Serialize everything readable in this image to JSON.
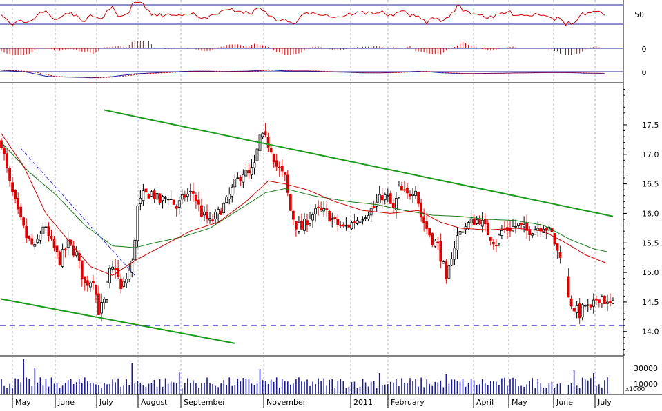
{
  "chart_data": {
    "type": "ohlc",
    "title": "",
    "price_axis": {
      "ylim": [
        13.6,
        18.2
      ],
      "ticks": [
        14.0,
        14.5,
        15.0,
        15.5,
        16.0,
        16.5,
        17.0,
        17.5
      ],
      "tick_labels": [
        "14.0",
        "14.5",
        "15.0",
        "15.5",
        "16.0",
        "16.5",
        "17.0",
        "17.5"
      ]
    },
    "indicator_axes": {
      "rsi": {
        "tick_labels": [
          "50"
        ],
        "upper_line": 70,
        "lower_line": 30
      },
      "macd_histogram": {
        "tick_labels": [
          "0"
        ]
      },
      "macd": {
        "tick_labels": [
          "0"
        ]
      }
    },
    "volume_axis": {
      "tick_labels": [
        "30000",
        "10000"
      ],
      "multiplier_label": "x1000"
    },
    "months": [
      "May",
      "June",
      "July",
      "August",
      "September",
      "November",
      "2011",
      "February",
      "April",
      "May",
      "June",
      "July"
    ],
    "close_path": [
      [
        0,
        17.2
      ],
      [
        3,
        16.5
      ],
      [
        6,
        16.0
      ],
      [
        9,
        15.6
      ],
      [
        12,
        15.4
      ],
      [
        15,
        15.8
      ],
      [
        18,
        15.5
      ],
      [
        21,
        15.2
      ],
      [
        24,
        15.5
      ],
      [
        27,
        15.3
      ],
      [
        30,
        14.8
      ],
      [
        33,
        14.9
      ],
      [
        35,
        14.35
      ],
      [
        37,
        14.5
      ],
      [
        39,
        15.0
      ],
      [
        41,
        15.1
      ],
      [
        43,
        14.7
      ],
      [
        45,
        14.9
      ],
      [
        47,
        15.15
      ],
      [
        48,
        15.6
      ],
      [
        49,
        16.1
      ],
      [
        51,
        16.3
      ],
      [
        54,
        16.35
      ],
      [
        57,
        16.2
      ],
      [
        60,
        16.3
      ],
      [
        63,
        16.1
      ],
      [
        66,
        16.3
      ],
      [
        69,
        16.35
      ],
      [
        72,
        16.0
      ],
      [
        75,
        15.85
      ],
      [
        78,
        16.0
      ],
      [
        81,
        16.2
      ],
      [
        84,
        16.5
      ],
      [
        87,
        16.7
      ],
      [
        89,
        16.65
      ],
      [
        91,
        16.8
      ],
      [
        93,
        17.3
      ],
      [
        95,
        17.25
      ],
      [
        97,
        17.1
      ],
      [
        99,
        16.8
      ],
      [
        102,
        16.6
      ],
      [
        104,
        16.05
      ],
      [
        106,
        15.8
      ],
      [
        108,
        15.75
      ],
      [
        111,
        15.95
      ],
      [
        114,
        16.05
      ],
      [
        117,
        16.0
      ],
      [
        120,
        15.85
      ],
      [
        123,
        15.75
      ],
      [
        125,
        15.8
      ],
      [
        128,
        15.9
      ],
      [
        131,
        16.0
      ],
      [
        134,
        16.1
      ],
      [
        137,
        16.3
      ],
      [
        139,
        16.25
      ],
      [
        141,
        16.05
      ],
      [
        143,
        16.4
      ],
      [
        146,
        16.3
      ],
      [
        149,
        16.45
      ],
      [
        151,
        15.95
      ],
      [
        153,
        15.75
      ],
      [
        155,
        15.55
      ],
      [
        157,
        15.45
      ],
      [
        159,
        15.1
      ],
      [
        160,
        14.8
      ],
      [
        162,
        15.3
      ],
      [
        164,
        15.6
      ],
      [
        166,
        15.75
      ],
      [
        169,
        15.85
      ],
      [
        172,
        15.9
      ],
      [
        174,
        15.75
      ],
      [
        176,
        15.6
      ],
      [
        178,
        15.5
      ],
      [
        180,
        15.7
      ],
      [
        183,
        15.75
      ],
      [
        186,
        15.8
      ],
      [
        189,
        15.7
      ],
      [
        192,
        15.75
      ],
      [
        195,
        15.8
      ],
      [
        198,
        15.65
      ],
      [
        200,
        15.35
      ],
      [
        202,
        15.3
      ],
      [
        204,
        14.55
      ],
      [
        206,
        14.4
      ],
      [
        208,
        14.3
      ],
      [
        210,
        14.45
      ],
      [
        212,
        14.35
      ],
      [
        214,
        14.55
      ],
      [
        216,
        14.6
      ],
      [
        218,
        14.45
      ]
    ],
    "ma_long_path": [
      [
        0,
        17.2
      ],
      [
        10,
        16.7
      ],
      [
        20,
        16.3
      ],
      [
        30,
        15.8
      ],
      [
        40,
        15.45
      ],
      [
        48,
        15.42
      ],
      [
        55,
        15.5
      ],
      [
        65,
        15.6
      ],
      [
        75,
        15.75
      ],
      [
        85,
        16.05
      ],
      [
        95,
        16.35
      ],
      [
        102,
        16.42
      ],
      [
        112,
        16.3
      ],
      [
        125,
        16.2
      ],
      [
        135,
        16.15
      ],
      [
        145,
        16.05
      ],
      [
        155,
        15.97
      ],
      [
        165,
        15.95
      ],
      [
        175,
        15.9
      ],
      [
        185,
        15.88
      ],
      [
        195,
        15.8
      ],
      [
        205,
        15.55
      ],
      [
        213,
        15.4
      ],
      [
        218,
        15.35
      ]
    ],
    "ma_short_path": [
      [
        0,
        17.35
      ],
      [
        8,
        16.8
      ],
      [
        16,
        16.0
      ],
      [
        24,
        15.55
      ],
      [
        32,
        15.1
      ],
      [
        40,
        14.95
      ],
      [
        48,
        15.2
      ],
      [
        58,
        15.45
      ],
      [
        68,
        15.7
      ],
      [
        78,
        15.85
      ],
      [
        88,
        16.2
      ],
      [
        96,
        16.55
      ],
      [
        102,
        16.5
      ],
      [
        110,
        16.4
      ],
      [
        120,
        16.2
      ],
      [
        130,
        16.05
      ],
      [
        140,
        16.0
      ],
      [
        150,
        16.05
      ],
      [
        158,
        15.85
      ],
      [
        165,
        15.75
      ],
      [
        175,
        15.72
      ],
      [
        185,
        15.75
      ],
      [
        195,
        15.7
      ],
      [
        203,
        15.5
      ],
      [
        210,
        15.3
      ],
      [
        218,
        15.15
      ]
    ],
    "trend_lines": [
      {
        "name": "",
        "from": [
          37,
          17.75
        ],
        "to": [
          220,
          15.95
        ]
      },
      {
        "name": "",
        "from": [
          0,
          14.55
        ],
        "to": [
          84,
          13.8
        ]
      },
      {
        "name": "",
        "from": [
          7,
          17.1
        ],
        "to": [
          48,
          14.95
        ]
      }
    ],
    "support_level": 14.1
  }
}
